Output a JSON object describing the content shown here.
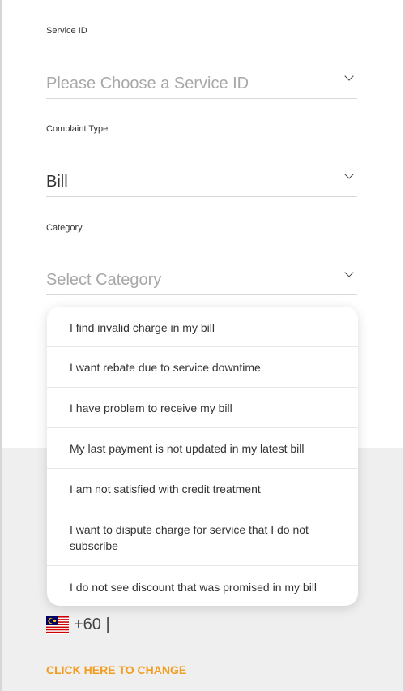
{
  "form": {
    "service_id": {
      "label": "Service ID",
      "placeholder": "Please Choose a Service ID"
    },
    "complaint_type": {
      "label": "Complaint Type",
      "value": "Bill"
    },
    "category": {
      "label": "Category",
      "placeholder": "Select Category"
    }
  },
  "dropdown": {
    "options": [
      "I find invalid charge in my bill",
      "I want rebate due to service downtime",
      "I have problem to receive my bill",
      "My last payment is not updated in my latest bill",
      "I am not satisfied with credit treatment",
      "I want to dispute charge for service that I do not subscribe",
      "I do not see discount that was promised in my bill"
    ]
  },
  "phone": {
    "country_icon": "malaysia-flag-icon",
    "code": "+60 |"
  },
  "change_link": "CLICK HERE TO CHANGE",
  "colors": {
    "accent": "#f39c1e",
    "text": "#333333",
    "placeholder": "#a8a8a8",
    "panel_bg": "#efefef"
  }
}
